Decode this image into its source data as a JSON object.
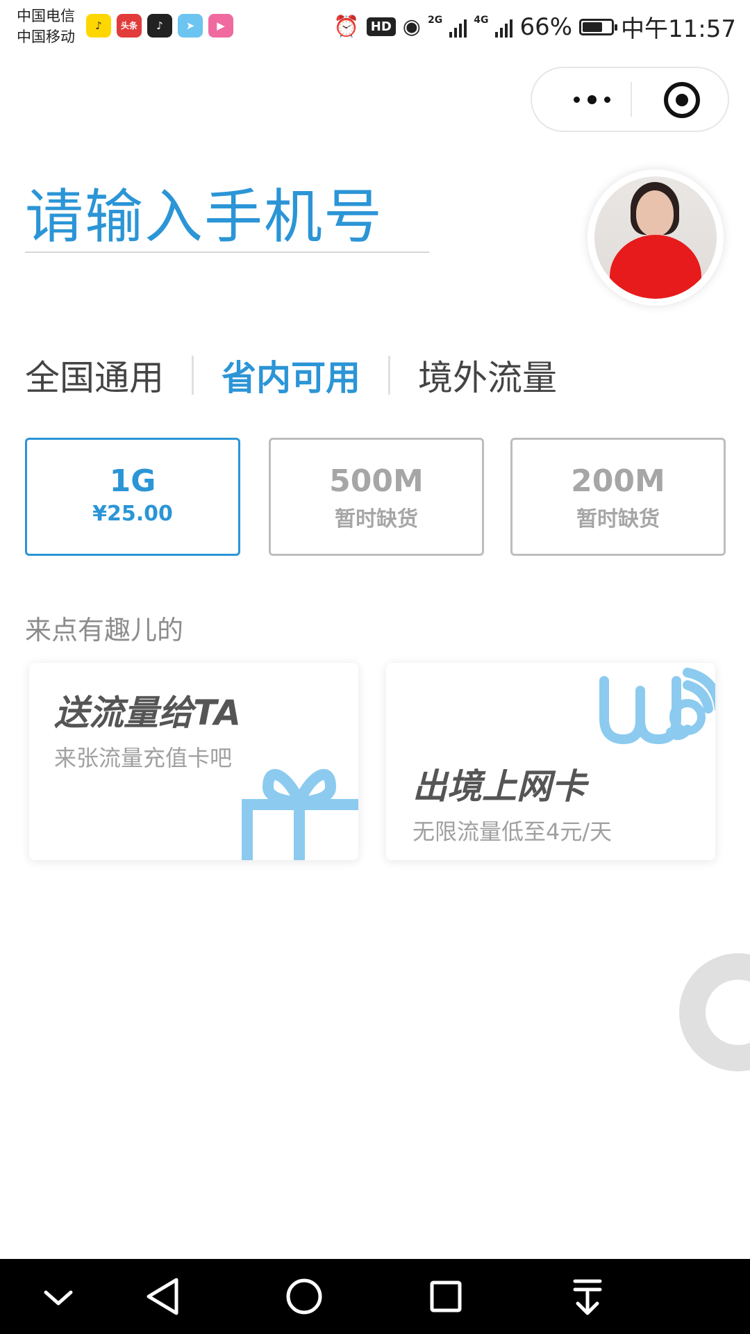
{
  "status_bar": {
    "carrier_1": "中国电信",
    "carrier_2": "中国移动",
    "app_icon_1": "♪",
    "app_icon_2": "头条",
    "app_icon_3": "♪",
    "app_icon_4": "➤",
    "app_icon_5": "▶",
    "hd": "HD",
    "net_1": "2G",
    "net_2": "4G",
    "battery": "66%",
    "time": "中午11:57"
  },
  "phone_input": {
    "placeholder": "请输入手机号"
  },
  "tabs": [
    {
      "label": "全国通用",
      "active": false
    },
    {
      "label": "省内可用",
      "active": true
    },
    {
      "label": "境外流量",
      "active": false
    }
  ],
  "packages": [
    {
      "size": "1G",
      "sub": "¥25.00",
      "selected": true
    },
    {
      "size": "500M",
      "sub": "暂时缺货",
      "selected": false
    },
    {
      "size": "200M",
      "sub": "暂时缺货",
      "selected": false
    }
  ],
  "section_title": "来点有趣儿的",
  "fun_cards": [
    {
      "title": "送流量给TA",
      "subtitle": "来张流量充值卡吧",
      "icon": "gift-icon"
    },
    {
      "title": "出境上网卡",
      "subtitle": "无限流量低至4元/天",
      "icon": "we-wifi-icon"
    }
  ],
  "colors": {
    "accent": "#2b95d6",
    "icon_light_blue": "#8ccbef",
    "muted_text": "#a6a6a6"
  }
}
